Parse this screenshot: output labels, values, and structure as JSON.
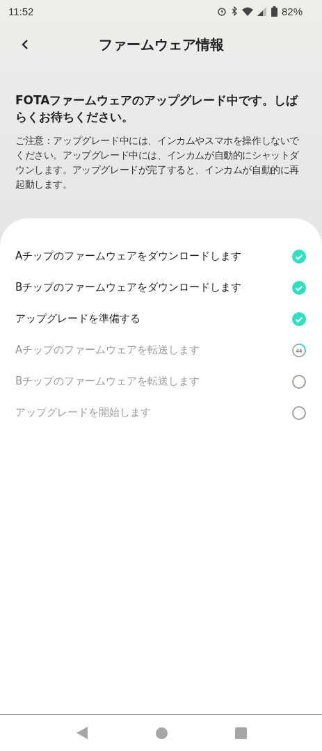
{
  "status_bar": {
    "time": "11:52",
    "battery": "82%"
  },
  "header": {
    "title": "ファームウェア情報"
  },
  "heading": "FOTAファームウェアのアップグレード中です。しばらくお待ちください。",
  "notice": "ご注意：アップグレード中には、インカムやスマホを操作しないでください。アップグレード中には、インカムが自動的にシャットダウンします。アップグレードが完了すると、インカムが自動的に再起動します。",
  "steps": [
    {
      "label": "Aチップのファームウェアをダウンロードします",
      "kind": "done"
    },
    {
      "label": "Bチップのファームウェアをダウンロードします",
      "kind": "done"
    },
    {
      "label": "アップグレードを準備する",
      "kind": "done"
    },
    {
      "label": "Aチップのファームウェアを転送します",
      "kind": "progress",
      "progress": "44"
    },
    {
      "label": "Bチップのファームウェアを転送します",
      "kind": "pending"
    },
    {
      "label": "アップグレードを開始します",
      "kind": "pending"
    }
  ]
}
